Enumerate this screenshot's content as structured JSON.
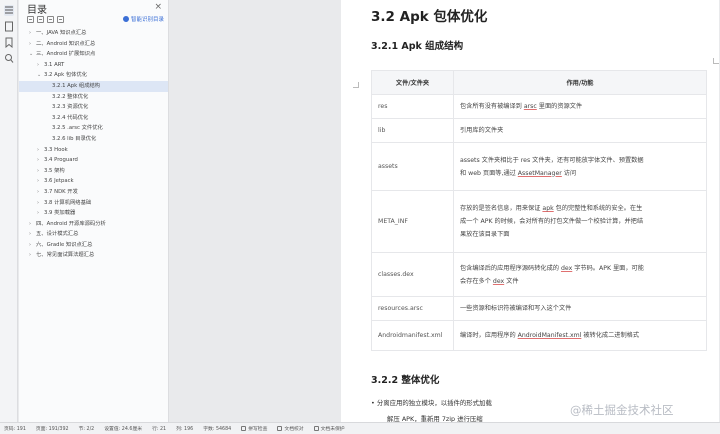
{
  "toc": {
    "title": "目录",
    "close": "×",
    "smart_toc": "智能识别目录",
    "items": [
      {
        "label": "一、JAVA 知识点汇总",
        "level": 0,
        "chev": "›"
      },
      {
        "label": "二、Android 知识点汇总",
        "level": 0,
        "chev": "›"
      },
      {
        "label": "三、Android 扩展知识点",
        "level": 0,
        "chev": "⌄"
      },
      {
        "label": "3.1 ART",
        "level": 1,
        "chev": "›"
      },
      {
        "label": "3.2 Apk 包体优化",
        "level": 1,
        "chev": "⌄"
      },
      {
        "label": "3.2.1 Apk 组成结构",
        "level": 2,
        "chev": "",
        "active": true
      },
      {
        "label": "3.2.2 整体优化",
        "level": 2,
        "chev": ""
      },
      {
        "label": "3.2.3 资源优化",
        "level": 2,
        "chev": ""
      },
      {
        "label": "3.2.4 代码优化",
        "level": 2,
        "chev": ""
      },
      {
        "label": "3.2.5 .arsc 文件优化",
        "level": 2,
        "chev": ""
      },
      {
        "label": "3.2.6 lib 目录优化",
        "level": 2,
        "chev": ""
      },
      {
        "label": "3.3 Hook",
        "level": 1,
        "chev": "›"
      },
      {
        "label": "3.4 Proguard",
        "level": 1,
        "chev": "›"
      },
      {
        "label": "3.5 架构",
        "level": 1,
        "chev": "›"
      },
      {
        "label": "3.6 Jetpack",
        "level": 1,
        "chev": "›"
      },
      {
        "label": "3.7 NDK 开发",
        "level": 1,
        "chev": "›"
      },
      {
        "label": "3.8 计算机网络基础",
        "level": 1,
        "chev": "›"
      },
      {
        "label": "3.9 类加载器",
        "level": 1,
        "chev": "›"
      },
      {
        "label": "四、Android 开源库源码分析",
        "level": 0,
        "chev": "›"
      },
      {
        "label": "五、设计模式汇总",
        "level": 0,
        "chev": "›"
      },
      {
        "label": "六、Gradle 知识点汇总",
        "level": 0,
        "chev": "›"
      },
      {
        "label": "七、常见面试算法题汇总",
        "level": 0,
        "chev": "›"
      }
    ]
  },
  "doc": {
    "h1": "3.2 Apk 包体优化",
    "h2": "3.2.1 Apk 组成结构",
    "table": {
      "headers": [
        "文件/文件夹",
        "作用/功能"
      ],
      "rows": [
        {
          "name": "res",
          "lines": [
            [
              {
                "t": "包含所有没有被编译到 "
              },
              {
                "t": "arsc",
                "u": true
              },
              {
                "t": " 里面的资源文件"
              }
            ]
          ]
        },
        {
          "name": "lib",
          "lines": [
            [
              {
                "t": "引用库的文件夹"
              }
            ]
          ]
        },
        {
          "name": "assets",
          "lines": [
            [
              {
                "t": "assets 文件夹相比于 res 文件夹，还有可能放字体文件、预置数据"
              }
            ],
            [
              {
                "t": "和 web 页面等,通过 "
              },
              {
                "t": "AssetManager",
                "u": true
              },
              {
                "t": " 访问"
              }
            ]
          ]
        },
        {
          "name": "META_INF",
          "lines": [
            [
              {
                "t": "存放的是签名信息，用来保证 "
              },
              {
                "t": "apk",
                "u": true
              },
              {
                "t": " 包的完整性和系统的安全。在生"
              }
            ],
            [
              {
                "t": "成一个 APK 的时候，会对所有的打包文件做一个校验计算，并把结"
              }
            ],
            [
              {
                "t": "果放在该目录下面"
              }
            ]
          ]
        },
        {
          "name": "classes.dex",
          "lines": [
            [
              {
                "t": "包含编译后的应用程序源码转化成的 "
              },
              {
                "t": "dex",
                "u": true
              },
              {
                "t": " 字节码。APK 里面，可能"
              }
            ],
            [
              {
                "t": "会存在多个 "
              },
              {
                "t": "dex",
                "u": true
              },
              {
                "t": " 文件"
              }
            ]
          ]
        },
        {
          "name": "resources.arsc",
          "lines": [
            [
              {
                "t": "一些资源和标识符被编译和写入这个文件"
              }
            ]
          ]
        },
        {
          "name": "Androidmanifest.xml",
          "lines": [
            [
              {
                "t": "编译时，应用程序的 "
              },
              {
                "t": "AndroidManifest.xml",
                "u": true
              },
              {
                "t": " 被转化成二进制格式"
              }
            ]
          ]
        }
      ]
    },
    "h3": "3.2.2 整体优化",
    "bullet": "分离应用的独立模块，以插件的形式加载",
    "bullet2": "解压 APK，重新用 7zip 进行压缩"
  },
  "watermark": "@稀土掘金技术社区",
  "status": {
    "page": "页码: 191",
    "pages": "页面: 191/392",
    "section": "节: 2/2",
    "setting": "设置值: 24.6厘米",
    "row": "行: 21",
    "col": "列: 196",
    "words": "字数: 54684",
    "spell": "拼写检查",
    "proof": "文档校对",
    "protect": "文档未保护"
  }
}
